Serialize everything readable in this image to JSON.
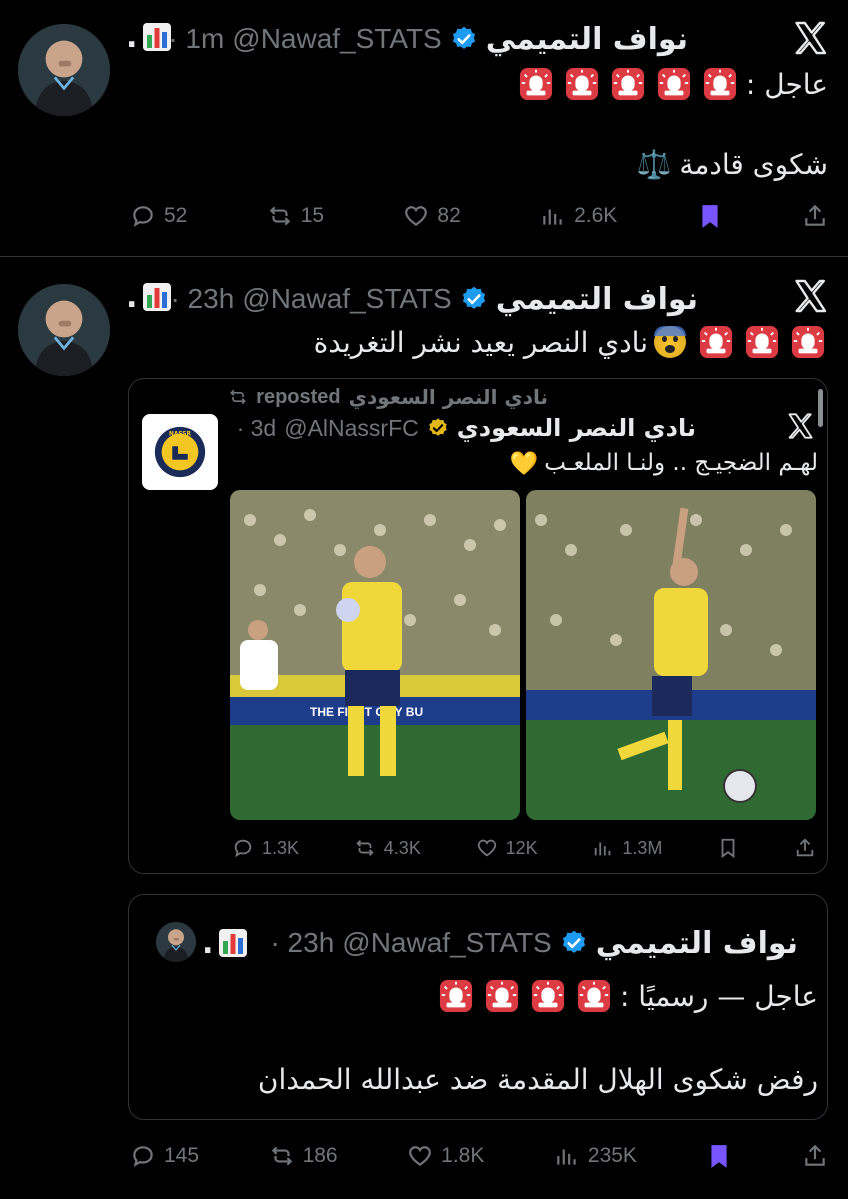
{
  "tweet1": {
    "display_name": "نواف التميمي",
    "name_suffix": ".",
    "handle": "@Nawaf_STATS",
    "time": "· 1m",
    "line1": "عاجل :",
    "line2": "شكوى قادمة",
    "scale_emoji": "⚖️",
    "stats": {
      "replies": "52",
      "reposts": "15",
      "likes": "82",
      "views": "2.6K"
    }
  },
  "tweet2": {
    "display_name": "نواف التميمي",
    "name_suffix": ".",
    "handle": "@Nawaf_STATS",
    "time": "· 23h",
    "line1": "نادي النصر يعيد نشر التغريدة",
    "embedded": {
      "reposted_label": "reposted",
      "reposted_by": "نادي النصر السعودي",
      "display_name": "نادي النصر السعودي",
      "handle": "@AlNassrFC",
      "time": "· 3d",
      "text": "لهـم الضجيـج .. ولنـا الملعـب",
      "heart_emoji": "💛",
      "stats": {
        "replies": "1.3K",
        "reposts": "4.3K",
        "likes": "12K",
        "views": "1.3M"
      },
      "board_text": "THE FIRST CITY BU",
      "logo_text": "NASSR"
    },
    "quoted": {
      "display_name": "نواف التميمي",
      "name_suffix": ".",
      "handle": "@Nawaf_STATS",
      "time": "· 23h",
      "line1": "عاجل — رسميًا :",
      "line2": "رفض شكوى الهلال المقدمة ضد عبدالله الحمدان"
    },
    "stats": {
      "replies": "145",
      "reposts": "186",
      "likes": "1.8K",
      "views": "235K"
    }
  },
  "colors": {
    "background": "#000000",
    "text": "#e7e9ea",
    "muted": "#71767b",
    "verified": "#1d9bf0",
    "bookmark": "#7856ff",
    "siren": "#e0245e",
    "divider": "#2f3336"
  },
  "icons": [
    "x-logo-icon",
    "verified-badge-icon",
    "bar-chart-emoji",
    "siren-emoji",
    "reply-icon",
    "repost-icon",
    "like-icon",
    "views-icon",
    "bookmark-icon",
    "share-icon"
  ]
}
